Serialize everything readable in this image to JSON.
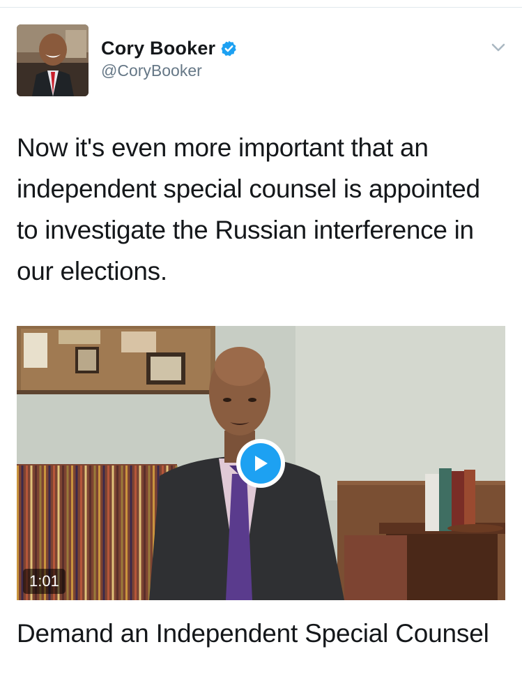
{
  "tweet": {
    "author": {
      "display_name": "Cory Booker",
      "handle": "@CoryBooker",
      "verified": true,
      "verified_icon": "verified-badge-icon",
      "avatar_icon": "avatar-photo"
    },
    "menu_icon": "chevron-down-icon",
    "text": "Now it's even more important that an independent special counsel is appointed to investigate the Russian interference in our elections.",
    "media": {
      "type": "video",
      "duration": "1:01",
      "play_icon": "play-icon"
    },
    "card_title": "Demand an Independent Special Counsel"
  },
  "colors": {
    "accent": "#1da1f2",
    "text": "#14171a",
    "secondary_text": "#657786"
  }
}
